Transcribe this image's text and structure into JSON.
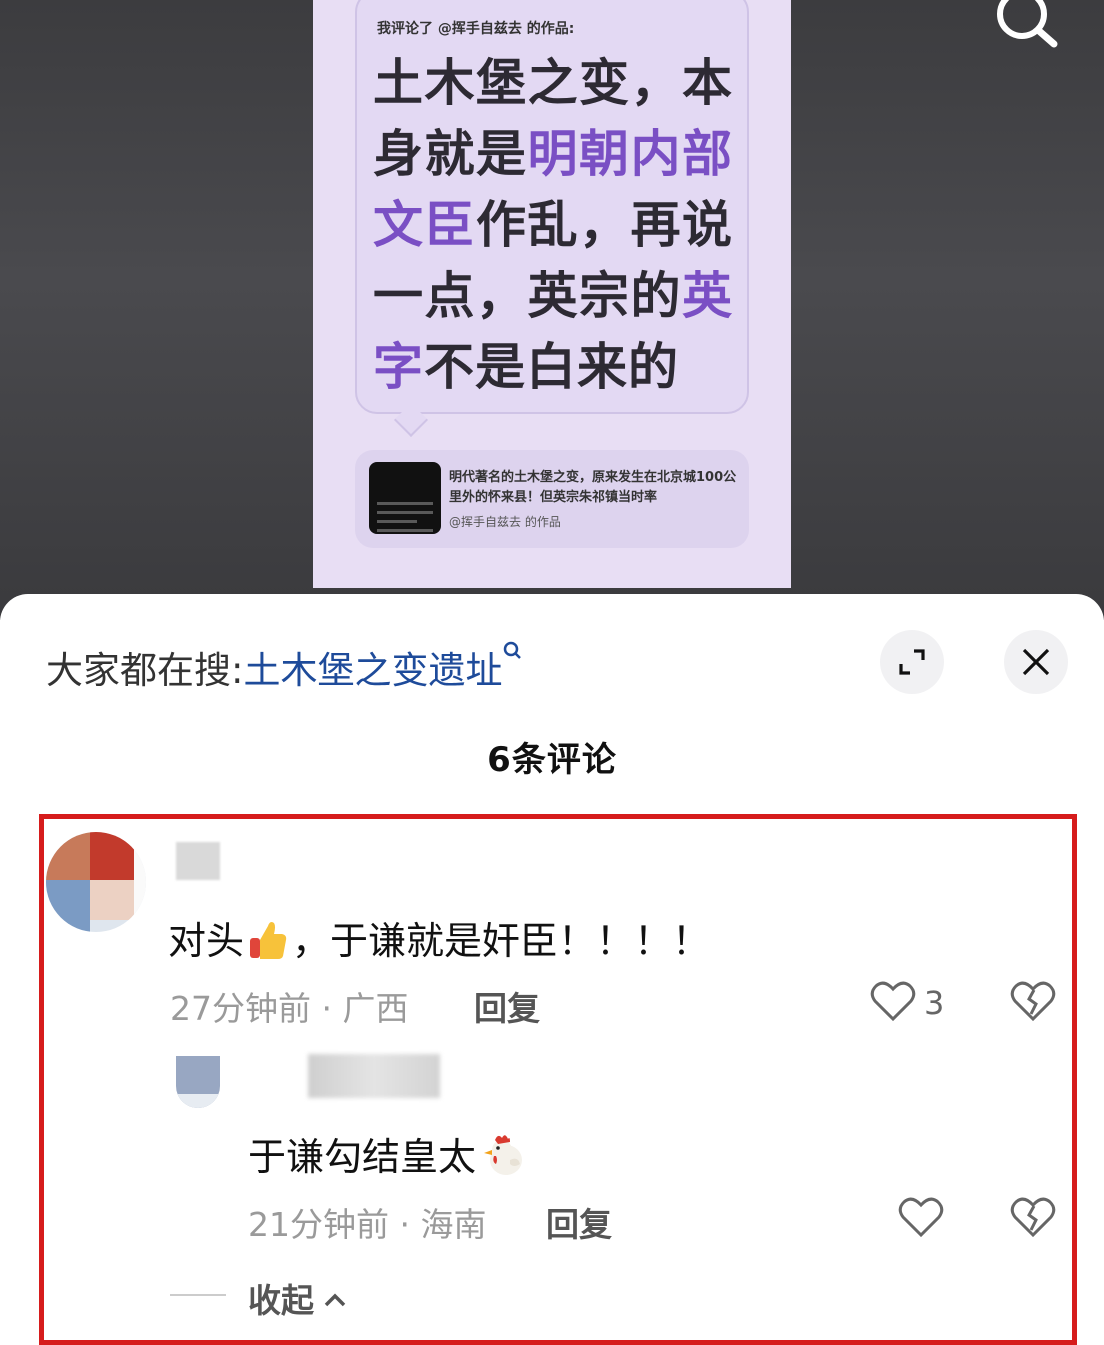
{
  "video": {
    "poster_header": "我评论了 @挥手自兹去 的作品:",
    "quote_parts": {
      "p1": "土木堡之变，本身就是",
      "h1": "明朝内部文臣",
      "p2": "作乱，再说一点，英宗的",
      "h2": "英字",
      "p3": "不是白来的"
    },
    "ref_card": {
      "text": "明代著名的土木堡之变，原来发生在北京城100公里外的怀来县！但英宗朱祁镇当时率",
      "author": "@挥手自兹去 的作品"
    }
  },
  "sheet": {
    "suggest_prefix": "大家都在搜:",
    "suggest_keyword": "土木堡之变遗址",
    "comment_count": "6条评论"
  },
  "comments": [
    {
      "text_before": "对头",
      "text_after": "，于谦就是奸臣！！！！",
      "time": "27分钟前 · 广西",
      "reply": "回复",
      "likes": "3"
    },
    {
      "text": "于谦勾结皇太",
      "time": "21分钟前 · 海南",
      "reply": "回复"
    }
  ],
  "collapse_label": "收起",
  "icons": [
    "search-icon",
    "expand-icon",
    "close-icon",
    "heart-icon",
    "dislike-icon",
    "chevron-up-icon"
  ],
  "colors": {
    "highlight_border": "#d61c1c",
    "keyword": "#1e4b9a",
    "quote_highlight": "#7a4fc4"
  }
}
